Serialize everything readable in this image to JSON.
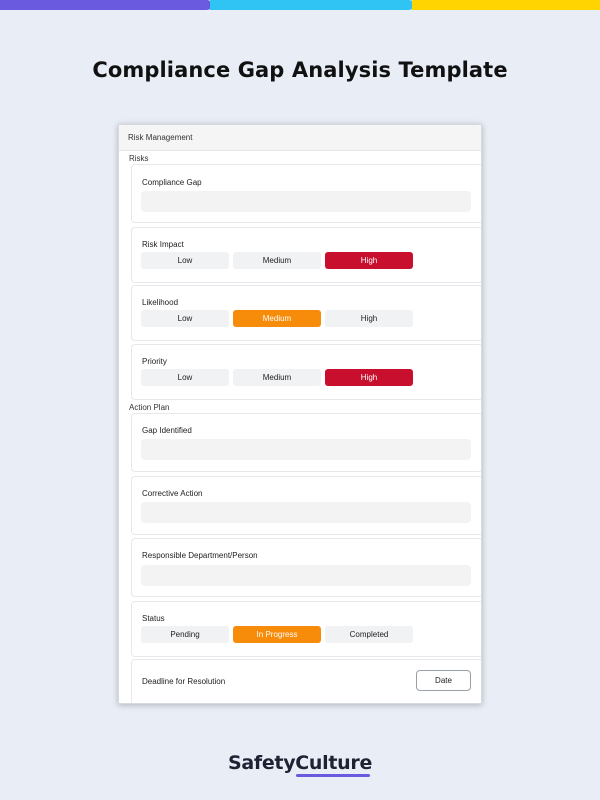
{
  "page_title": "Compliance Gap Analysis Template",
  "colors": {
    "bar_purple": "#6a5ae0",
    "bar_blue": "#2fc4f3",
    "bar_yellow": "#ffd400",
    "high_red": "#c8102e",
    "selected_orange": "#f78b0a"
  },
  "form": {
    "header": "Risk Management",
    "risks": {
      "label": "Risks",
      "compliance_gap": {
        "label": "Compliance Gap",
        "value": ""
      },
      "risk_impact": {
        "label": "Risk Impact",
        "options": [
          "Low",
          "Medium",
          "High"
        ],
        "selected": "High"
      },
      "likelihood": {
        "label": "Likelihood",
        "options": [
          "Low",
          "Medium",
          "High"
        ],
        "selected": "Medium"
      },
      "priority": {
        "label": "Priority",
        "options": [
          "Low",
          "Medium",
          "High"
        ],
        "selected": "High"
      }
    },
    "action_plan": {
      "label": "Action Plan",
      "gap_identified": {
        "label": "Gap Identified",
        "value": ""
      },
      "corrective_action": {
        "label": "Corrective Action",
        "value": ""
      },
      "responsible": {
        "label": "Responsible Department/Person",
        "value": ""
      },
      "status": {
        "label": "Status",
        "options": [
          "Pending",
          "In Progress",
          "Completed"
        ],
        "selected": "In Progress"
      },
      "deadline": {
        "label": "Deadline for Resolution",
        "button": "Date"
      }
    }
  },
  "logo": {
    "text": "SafetyCulture"
  }
}
